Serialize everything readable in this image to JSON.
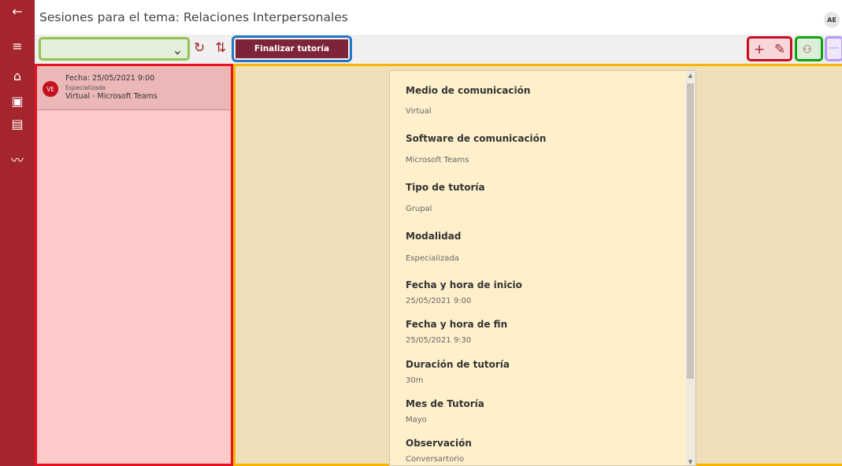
{
  "header": {
    "back_icon": "arrow-left-icon",
    "title": "Sesiones para el tema: Relaciones Interpersonales",
    "avatar": "AE"
  },
  "nav": {
    "items": [
      {
        "name": "menu-icon",
        "glyph": "≡"
      },
      {
        "name": "home-icon",
        "glyph": "⌂"
      },
      {
        "name": "contact-card-icon",
        "glyph": "▣"
      },
      {
        "name": "pdf-icon",
        "glyph": "▤"
      },
      {
        "name": "chart-icon",
        "glyph": "〰"
      }
    ]
  },
  "toolbar": {
    "dropdown_value": "",
    "refresh_icon": "refresh-icon",
    "sort_icon": "sort-icon",
    "finalize_label": "Finalizar tutoría",
    "add_icon": "plus-icon",
    "edit_icon": "pencil-icon",
    "people_icon": "people-icon",
    "more_icon": "more-icon"
  },
  "sessions": [
    {
      "avatar": "VE",
      "date": "Fecha: 25/05/2021 9:00",
      "type": "Especializada",
      "mode": "Virtual - Microsoft Teams"
    }
  ],
  "details": {
    "fields": [
      {
        "label": "Medio de comunicación",
        "value": "Virtual"
      },
      {
        "label": "Software de comunicación",
        "value": "Microsoft Teams"
      },
      {
        "label": "Tipo de tutoría",
        "value": "Grupal"
      },
      {
        "label": "Modalidad",
        "value": "Especializada"
      },
      {
        "label": "Fecha y hora de inicio",
        "value": "25/05/2021 9:00"
      },
      {
        "label": "Fecha y hora de fin",
        "value": "25/05/2021 9:30"
      },
      {
        "label": "Duración de tutoría",
        "value": "30m"
      },
      {
        "label": "Mes de Tutoría",
        "value": "Mayo"
      },
      {
        "label": "Observación",
        "value": "Conversartorio"
      }
    ]
  },
  "colors": {
    "rail": "#a4262c",
    "accent": "#7d2438",
    "left_panel": "#ffcaca",
    "right_panel": "#efe0b9"
  }
}
